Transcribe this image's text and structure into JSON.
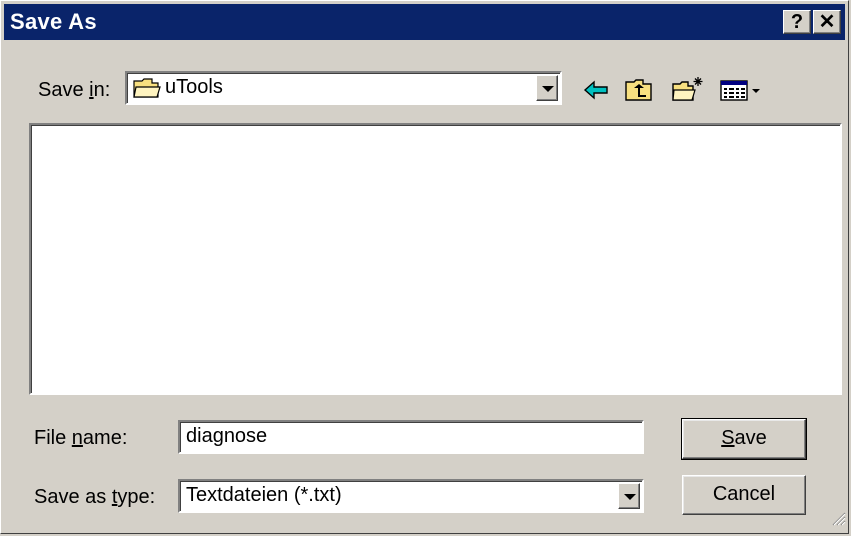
{
  "window": {
    "title": "Save As",
    "help_glyph": "?",
    "close_glyph": "✕"
  },
  "toolbar": {
    "save_in_label_pre": "Save ",
    "save_in_label_u": "i",
    "save_in_label_post": "n:",
    "folder": "uTools",
    "icons": [
      "back-arrow-icon",
      "up-folder-icon",
      "new-folder-icon",
      "view-menu-icon"
    ]
  },
  "file_list": {
    "items": []
  },
  "form": {
    "filename_label_pre": "File ",
    "filename_label_u": "n",
    "filename_label_post": "ame:",
    "filename_value": "diagnose",
    "type_label_pre": "Save as ",
    "type_label_u": "t",
    "type_label_post": "ype:",
    "type_value": "Textdateien (*.txt)"
  },
  "buttons": {
    "save_u": "S",
    "save_rest": "ave",
    "cancel": "Cancel"
  },
  "colors": {
    "titlebar": "#0a246a",
    "face": "#d4d0c8",
    "back_arrow": "#00c0c0",
    "folder": "#f8e080"
  }
}
